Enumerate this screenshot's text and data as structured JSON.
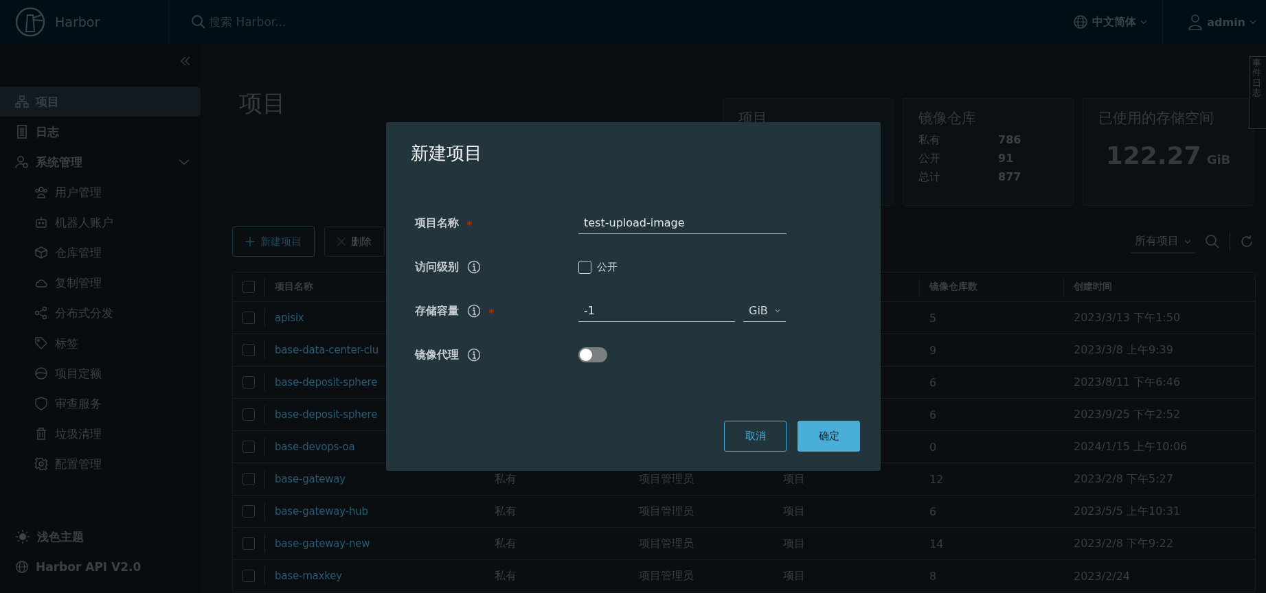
{
  "header": {
    "brand": "Harbor",
    "search": {
      "placeholder": "搜索 Harbor..."
    },
    "language": "中文简体",
    "user": "admin"
  },
  "sidebar": {
    "items": [
      {
        "label": "项目",
        "selected": true
      },
      {
        "label": "日志",
        "selected": false
      },
      {
        "label": "系统管理",
        "selected": false,
        "expanded": true,
        "children": [
          {
            "label": "用户管理",
            "selected": false
          },
          {
            "label": "机器人账户",
            "selected": false
          },
          {
            "label": "仓库管理",
            "selected": false
          },
          {
            "label": "复制管理",
            "selected": false
          },
          {
            "label": "分布式分发",
            "selected": false
          },
          {
            "label": "标签",
            "selected": false
          },
          {
            "label": "项目定额",
            "selected": false
          },
          {
            "label": "审查服务",
            "selected": false
          },
          {
            "label": "垃圾清理",
            "selected": false
          },
          {
            "label": "配置管理",
            "selected": false
          }
        ]
      }
    ],
    "footer": [
      "浅色主题",
      "Harbor API V2.0"
    ]
  },
  "page_title": "项目",
  "side_tab": "事件日志",
  "cards": [
    {
      "title": "项目"
    },
    {
      "title": "镜像仓库",
      "rows": [
        {
          "label": "私有",
          "value": "786"
        },
        {
          "label": "公开",
          "value": "91"
        },
        {
          "label": "总计",
          "value": "877"
        }
      ]
    },
    {
      "title": "已使用的存储空间",
      "value": "122.27",
      "unit": "GiB"
    }
  ],
  "actions": [
    "新建项目",
    "删除"
  ],
  "filter": "所有项目",
  "table": {
    "header_checked": false,
    "columns": [
      {
        "label": "项目名称"
      },
      {},
      {},
      {},
      {
        "label": "镜像仓库数"
      },
      {
        "label": "创建时间"
      }
    ],
    "rows": [
      {
        "checked": false,
        "cells": [
          "apisix",
          "",
          "",
          "",
          "5",
          "2023/3/13 下午1:50"
        ]
      },
      {
        "checked": false,
        "cells": [
          "base-data-center-clu",
          "",
          "",
          "",
          "9",
          "2023/3/8 上午9:39"
        ]
      },
      {
        "checked": false,
        "cells": [
          "base-deposit-sphere",
          "",
          "",
          "",
          "6",
          "2023/8/11 下午6:46"
        ]
      },
      {
        "checked": false,
        "cells": [
          "base-deposit-sphere",
          "",
          "",
          "",
          "6",
          "2023/9/25 下午2:52"
        ]
      },
      {
        "checked": false,
        "cells": [
          "base-devops-oa",
          "",
          "",
          "",
          "0",
          "2024/1/15 上午10:06"
        ]
      },
      {
        "checked": false,
        "cells": [
          "base-gateway",
          "私有",
          "项目管理员",
          "项目",
          "12",
          "2023/2/8 下午5:27"
        ]
      },
      {
        "checked": false,
        "cells": [
          "base-gateway-hub",
          "私有",
          "项目管理员",
          "项目",
          "6",
          "2023/5/5 上午10:31"
        ]
      },
      {
        "checked": false,
        "cells": [
          "base-gateway-new",
          "私有",
          "项目管理员",
          "项目",
          "14",
          "2023/2/8 下午9:22"
        ]
      },
      {
        "checked": false,
        "cells": [
          "base-maxkey",
          "私有",
          "项目管理员",
          "项目",
          "8",
          "2023/2/24"
        ]
      }
    ]
  },
  "dialog": {
    "title": "新建项目",
    "fields": [
      {
        "kind": "text",
        "label": "项目名称",
        "required": true,
        "info": false,
        "value": "test-upload-image"
      },
      {
        "kind": "checkbox",
        "label": "访问级别",
        "required": false,
        "info": true,
        "option": "公开",
        "checked": false
      },
      {
        "kind": "quota",
        "label": "存储容量",
        "required": true,
        "info": true,
        "value": "-1",
        "unit": "GiB"
      },
      {
        "kind": "toggle",
        "label": "镜像代理",
        "required": false,
        "info": true,
        "on": false
      }
    ],
    "buttons": [
      {
        "label": "取消",
        "kind": "secondary"
      },
      {
        "label": "确定",
        "kind": "primary"
      }
    ]
  }
}
